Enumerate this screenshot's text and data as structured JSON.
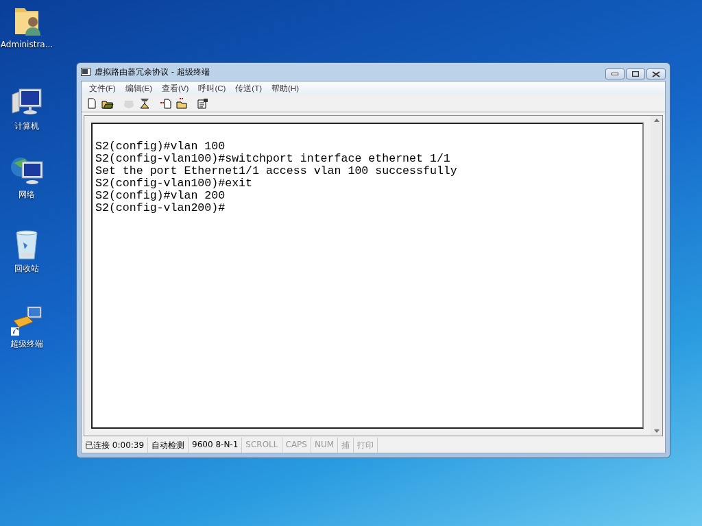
{
  "desktop_icons": [
    {
      "kind": "user-folder",
      "label": "Administra..."
    },
    {
      "kind": "computer",
      "label": "计算机"
    },
    {
      "kind": "network",
      "label": "网络"
    },
    {
      "kind": "recycle-bin",
      "label": "回收站"
    },
    {
      "kind": "terminal-shortcut",
      "label": "超级终端"
    }
  ],
  "window": {
    "title": "虚拟路由器冗余协议 - 超级终端"
  },
  "menu": [
    "文件(F)",
    "编辑(E)",
    "查看(V)",
    "呼叫(C)",
    "传送(T)",
    "帮助(H)"
  ],
  "toolbar": [
    {
      "kind": "new",
      "disabled": false
    },
    {
      "kind": "open",
      "disabled": false
    },
    {
      "kind": "call",
      "disabled": true
    },
    {
      "kind": "hangup",
      "disabled": false
    },
    {
      "kind": "send",
      "disabled": false
    },
    {
      "kind": "receive",
      "disabled": false
    },
    {
      "kind": "properties",
      "disabled": false
    }
  ],
  "terminal": {
    "lines": [
      "S2(config)#vlan 100",
      "S2(config-vlan100)#switchport interface ethernet 1/1",
      "Set the port Ethernet1/1 access vlan 100 successfully",
      "S2(config-vlan100)#exit",
      "S2(config)#vlan 200",
      "S2(config-vlan200)#"
    ]
  },
  "status_bar": [
    {
      "text": "已连接 0:00:39",
      "on": true
    },
    {
      "text": "自动检测",
      "on": true
    },
    {
      "text": "9600 8-N-1",
      "on": true
    },
    {
      "text": "SCROLL",
      "on": false
    },
    {
      "text": "CAPS",
      "on": false
    },
    {
      "text": "NUM",
      "on": false
    },
    {
      "text": "捕",
      "on": false
    },
    {
      "text": "打印",
      "on": false
    }
  ]
}
